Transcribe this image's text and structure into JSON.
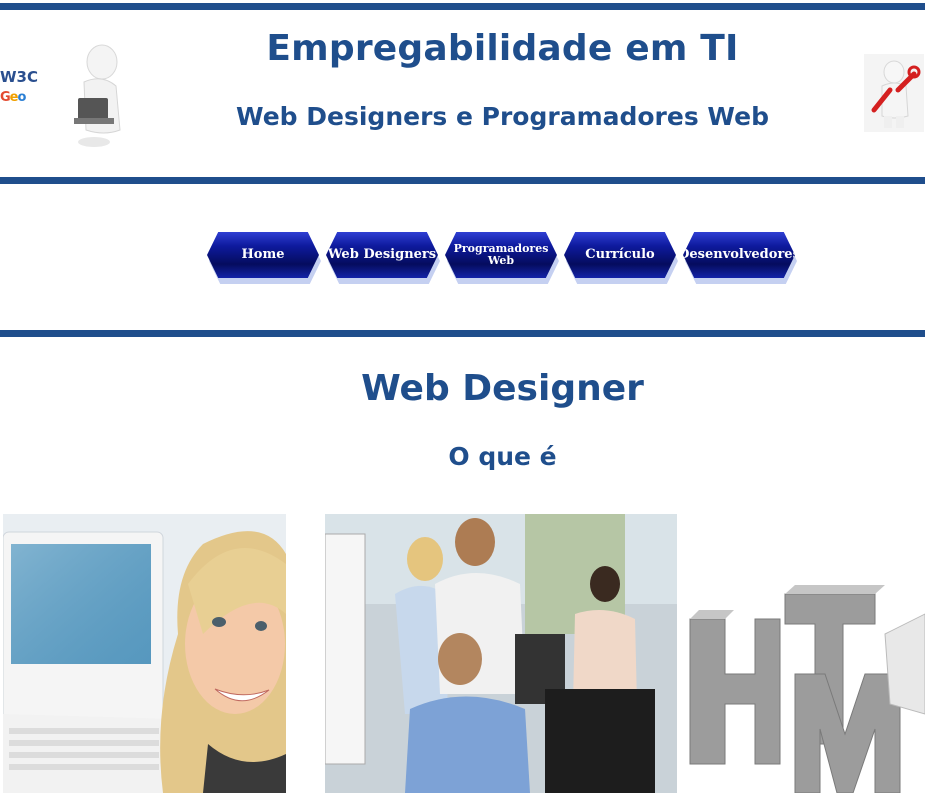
{
  "header": {
    "title": "Empregabilidade em TI",
    "subtitle": "Web Designers e Programadores Web",
    "logo_text_top": "W3C",
    "logo_text_bottom": "Geo"
  },
  "nav": {
    "items": [
      {
        "label": "Home"
      },
      {
        "label": "Web Designers"
      },
      {
        "label": "Programadores Web"
      },
      {
        "label": "Currículo"
      },
      {
        "label": "Desenvolvedores"
      }
    ],
    "button_colors": {
      "dark": "#050c5e",
      "mid": "#0e1a9e",
      "light": "#2f3fd3"
    }
  },
  "main": {
    "heading": "Web Designer",
    "subheading": "O que é",
    "photos": [
      {
        "icon": "woman-with-laptop-photo"
      },
      {
        "icon": "office-team-photo"
      },
      {
        "icon": "html-3d-letters-photo"
      }
    ]
  },
  "colors": {
    "accent": "#1f4e8c",
    "background": "#ffffff"
  }
}
